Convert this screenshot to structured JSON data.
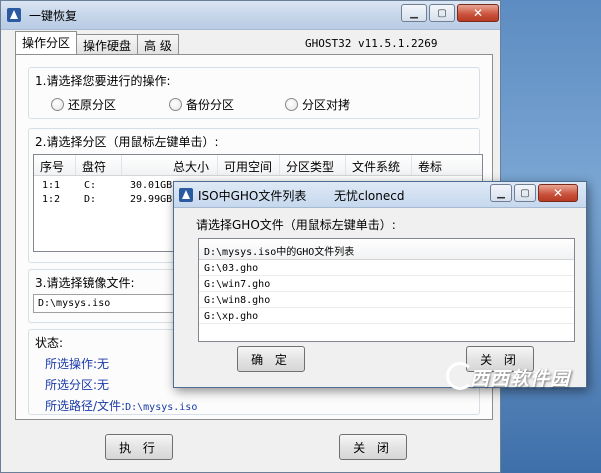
{
  "main_window": {
    "title": "一键恢复",
    "version": "GHOST32 v11.5.1.2269",
    "tabs": [
      "操作分区",
      "操作硬盘",
      "高 级"
    ],
    "operation_group": {
      "title": "1.请选择您要进行的操作:",
      "options": [
        "还原分区",
        "备份分区",
        "分区对拷"
      ]
    },
    "partition_group": {
      "title": "2.请选择分区（用鼠标左键单击）:",
      "columns": [
        "序号",
        "盘符",
        "总大小",
        "可用空间",
        "分区类型",
        "文件系统",
        "卷标"
      ],
      "rows": [
        [
          "1:1",
          "C:",
          "30.01GB"
        ],
        [
          "1:2",
          "D:",
          "29.99GB"
        ]
      ]
    },
    "image_group": {
      "title": "3.请选择镜像文件:",
      "value": "D:\\mysys.iso"
    },
    "status": {
      "title": "状态:",
      "operation_label": "所选操作:",
      "operation_value": "无",
      "partition_label": "所选分区:",
      "partition_value": "无",
      "path_label": "所选路径/文件:",
      "path_value": "D:\\mysys.iso"
    },
    "buttons": {
      "execute": "执 行",
      "close": "关 闭"
    }
  },
  "dialog": {
    "title": "ISO中GHO文件列表",
    "title_extra": "无忧clonecd",
    "prompt": "请选择GHO文件（用鼠标左键单击）:",
    "list_header": "D:\\mysys.iso中的GHO文件列表",
    "files": [
      "G:\\03.gho",
      "G:\\win7.gho",
      "G:\\win8.gho",
      "G:\\xp.gho"
    ],
    "buttons": {
      "ok": "确 定",
      "close": "关 闭"
    }
  },
  "watermark": "西西软件园",
  "colors": {
    "status_text": "#1a3aa8",
    "close_button": "#c9503a",
    "titlebar": "#c6d6ea"
  }
}
